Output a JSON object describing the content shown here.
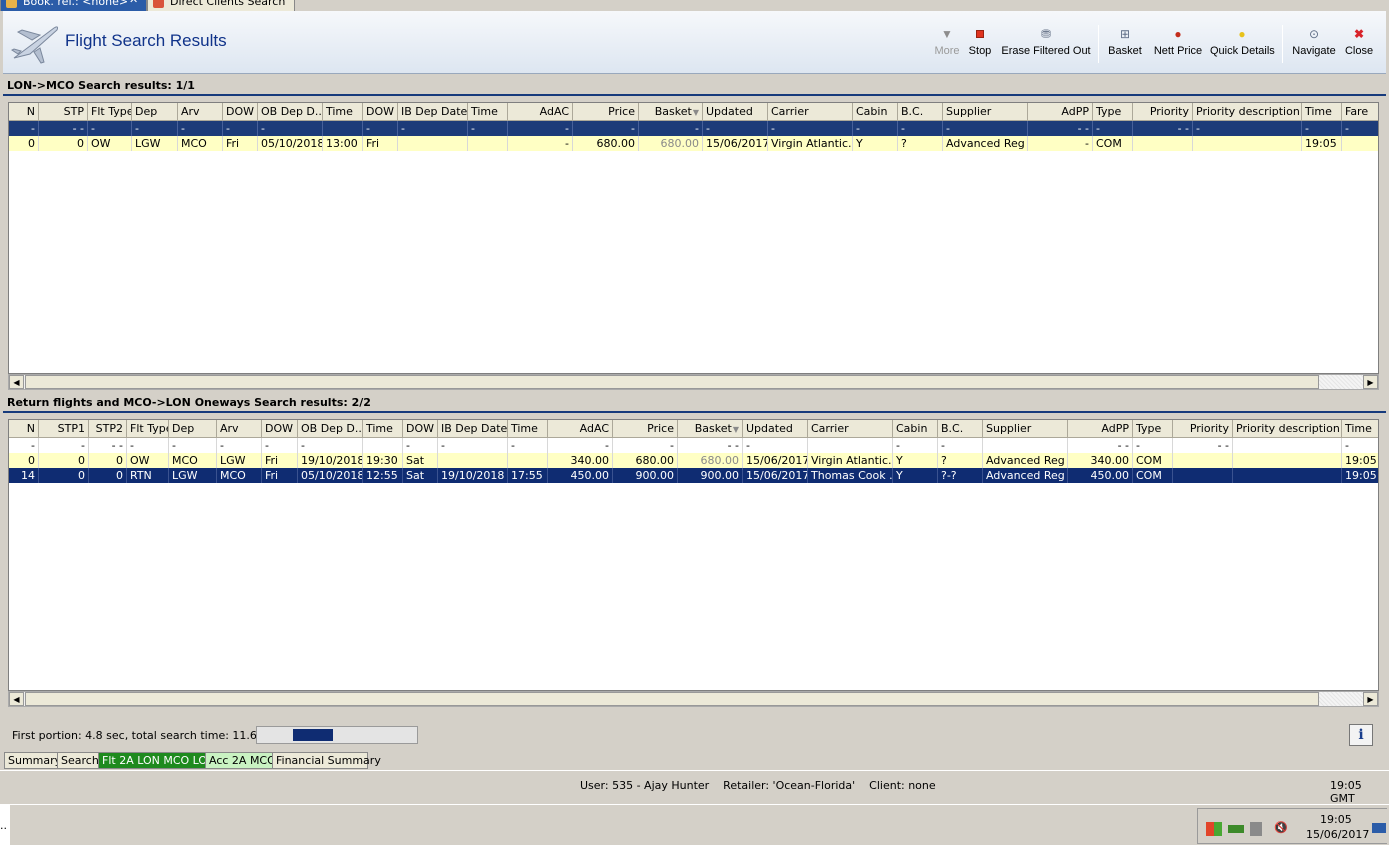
{
  "doc_tabs": [
    {
      "label": "Book. ref.: <none>",
      "active": true
    },
    {
      "label": "Direct Clients Search",
      "active": false
    }
  ],
  "header": {
    "title": "Flight Search Results"
  },
  "toolbar": {
    "more": "More",
    "stop": "Stop",
    "erase_filtered_out": "Erase Filtered Out",
    "basket": "Basket",
    "nett_price": "Nett Price",
    "quick_details": "Quick Details",
    "navigate": "Navigate",
    "close": "Close"
  },
  "outbound": {
    "title": "LON->MCO Search results: 1/1",
    "columns": [
      "N",
      "STP",
      "Flt Type",
      "Dep",
      "Arv",
      "DOW",
      "OB Dep D...",
      "Time",
      "DOW",
      "IB Dep Date",
      "Time",
      "AdAC",
      "Price",
      "Basket",
      "Updated",
      "Carrier",
      "Cabin",
      "B.C.",
      "Supplier",
      "AdPP",
      "Type",
      "Priority",
      "Priority description",
      "Time",
      "Fare"
    ],
    "filter": [
      "-",
      "- -",
      "-",
      "-",
      "-",
      "-",
      "-",
      "",
      "-",
      "-",
      "-",
      "-",
      "-",
      "-",
      "-",
      "-",
      "-",
      "-",
      "-",
      "- -",
      "-",
      "- -",
      "-",
      "-",
      "-"
    ],
    "rows": [
      [
        "0",
        "0",
        "OW",
        "LGW",
        "MCO",
        "Fri",
        "05/10/2018",
        "13:00",
        "Fri",
        "",
        "",
        "-",
        "680.00",
        "680.00",
        "15/06/2017",
        "Virgin Atlantic...",
        "Y",
        "?",
        "Advanced Reg",
        "-",
        "COM",
        "",
        "",
        "19:05",
        ""
      ]
    ]
  },
  "return": {
    "title": "Return flights and MCO->LON Oneways Search results: 2/2",
    "columns": [
      "N",
      "STP1",
      "STP2",
      "Flt Type",
      "Dep",
      "Arv",
      "DOW",
      "OB Dep D...",
      "Time",
      "DOW",
      "IB Dep Date",
      "Time",
      "AdAC",
      "Price",
      "Basket",
      "Updated",
      "Carrier",
      "Cabin",
      "B.C.",
      "Supplier",
      "AdPP",
      "Type",
      "Priority",
      "Priority description",
      "Time"
    ],
    "filter": [
      "-",
      "-",
      "- -",
      "-",
      "-",
      "-",
      "-",
      "-",
      "",
      "-",
      "-",
      "-",
      "-",
      "-",
      "- -",
      "-",
      "",
      "-",
      "-",
      "",
      "- -",
      "-",
      "- -",
      "",
      "-"
    ],
    "rows": [
      [
        "0",
        "0",
        "0",
        "OW",
        "MCO",
        "LGW",
        "Fri",
        "19/10/2018",
        "19:30",
        "Sat",
        "",
        "",
        "340.00",
        "680.00",
        "680.00",
        "15/06/2017",
        "Virgin Atlantic...",
        "Y",
        "?",
        "Advanced Reg",
        "340.00",
        "COM",
        "",
        "",
        "19:05"
      ],
      [
        "14",
        "0",
        "0",
        "RTN",
        "LGW",
        "MCO",
        "Fri",
        "05/10/2018",
        "12:55",
        "Sat",
        "19/10/2018",
        "17:55",
        "450.00",
        "900.00",
        "900.00",
        "15/06/2017",
        "Thomas Cook ...",
        "Y",
        "?-?",
        "Advanced Reg",
        "450.00",
        "COM",
        "",
        "",
        "19:05"
      ]
    ]
  },
  "status": {
    "search_time": "First portion: 4.8 sec, total search time: 11.6 sec",
    "progress": 0.25,
    "info_label": "i"
  },
  "bottom_tabs": [
    {
      "label": "Summary",
      "style": "normal"
    },
    {
      "label": "Search",
      "style": "normal"
    },
    {
      "label": "Flt 2A LON MCO LON",
      "style": "green"
    },
    {
      "label": "Acc 2A MCO",
      "style": "lightgreen"
    },
    {
      "label": "Financial Summary",
      "style": "normal"
    }
  ],
  "appbar": {
    "user_info": "User: 535 - Ajay Hunter    Retailer: 'Ocean-Florida'    Client: none",
    "clock": "19:05 GMT"
  },
  "taskbar": {
    "time": "19:05",
    "date": "15/06/2017"
  },
  "colors": {
    "accent_blue": "#0f2c72",
    "title_blue": "#10338a",
    "row_yellow": "#ffffc4",
    "tab_green": "#1e8a1e",
    "tab_lightgreen": "#c9f2c2"
  }
}
